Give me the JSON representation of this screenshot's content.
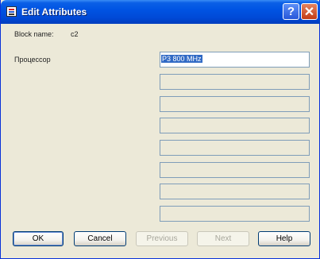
{
  "window": {
    "title": "Edit Attributes"
  },
  "block": {
    "label": "Block name:",
    "value": "c2"
  },
  "attributes": [
    {
      "label": "Процессор",
      "value": "P3 800 MHz"
    },
    {
      "label": "",
      "value": ""
    },
    {
      "label": "",
      "value": ""
    },
    {
      "label": "",
      "value": ""
    },
    {
      "label": "",
      "value": ""
    },
    {
      "label": "",
      "value": ""
    },
    {
      "label": "",
      "value": ""
    },
    {
      "label": "",
      "value": ""
    }
  ],
  "buttons": {
    "ok": "OK",
    "cancel": "Cancel",
    "previous": "Previous",
    "next": "Next",
    "help": "Help"
  },
  "colors": {
    "titlebar": "#0054e3",
    "selection": "#316ac5",
    "dialog_bg": "#ece9d8"
  }
}
